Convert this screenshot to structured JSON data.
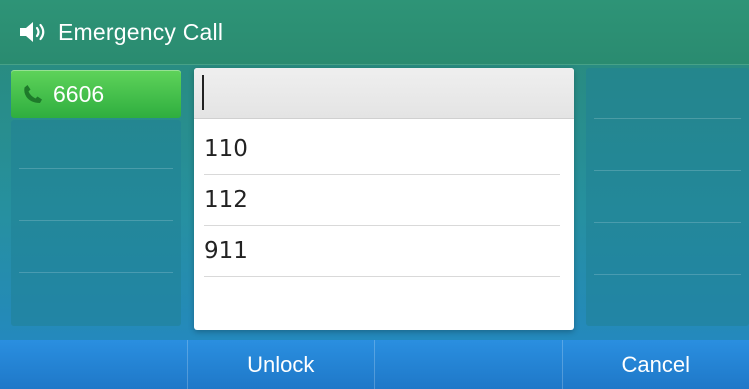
{
  "header": {
    "title": "Emergency Call",
    "icon": "speaker-icon"
  },
  "line_key": {
    "number": "6606",
    "icon": "phone-handset-icon",
    "color": "#3cbf46"
  },
  "dial_popup": {
    "input_value": "",
    "numbers": [
      "110",
      "112",
      "911"
    ]
  },
  "softkeys": [
    "",
    "Unlock",
    "",
    "Cancel"
  ],
  "colors": {
    "header": "#2a8b70",
    "softkey_bar": "#2386d6",
    "popup_background": "#ffffff"
  }
}
